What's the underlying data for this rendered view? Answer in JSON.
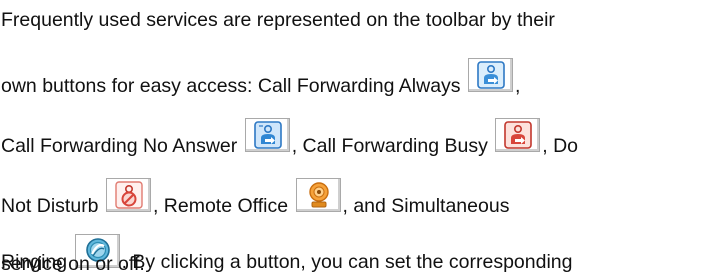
{
  "heading_fragment": "",
  "paragraph": {
    "line1": "Frequently used services are represented on the toolbar by their",
    "line2_a": "own buttons for easy access:  Call Forwarding Always",
    "line2_b": ",",
    "line3_a": "Call Forwarding No Answer",
    "line3_b": ", Call Forwarding Busy",
    "line3_c": ", Do",
    "line4_a": "Not Disturb",
    "line4_b": ", Remote Office",
    "line4_c": ", and Simultaneous",
    "line5_a": "Ringing",
    "line5_b": ".  By clicking a button, you can set the corresponding",
    "line6": "service on or off."
  },
  "icons": {
    "call_forwarding_always": "call-forwarding-always-icon",
    "call_forwarding_no_answer": "call-forwarding-no-answer-icon",
    "call_forwarding_busy": "call-forwarding-busy-icon",
    "do_not_disturb": "do-not-disturb-icon",
    "remote_office": "remote-office-icon",
    "simultaneous_ringing": "simultaneous-ringing-icon"
  },
  "colors": {
    "heading_green": "#3cae4a",
    "blue_icon": "#3a8fd8",
    "red_icon": "#d8443a",
    "orange_icon": "#f08a1e",
    "teal_icon": "#2f8fb5"
  }
}
